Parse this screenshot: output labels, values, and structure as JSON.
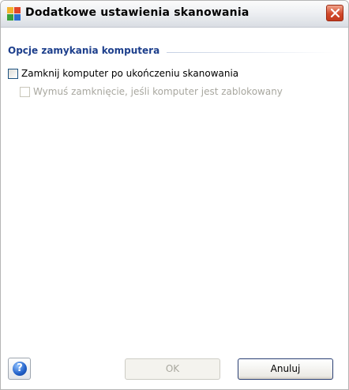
{
  "window": {
    "title": "Dodatkowe ustawienia skanowania"
  },
  "shutdown_group": {
    "title": "Opcje zamykania komputera",
    "options": [
      {
        "label": "Zamknij komputer po ukończeniu skanowania",
        "checked": false,
        "enabled": true
      },
      {
        "label": "Wymuś zamknięcie, jeśli komputer jest zablokowany",
        "checked": false,
        "enabled": false
      }
    ]
  },
  "footer": {
    "help_icon": "help-icon",
    "ok_label": "OK",
    "cancel_label": "Anuluj"
  },
  "colors": {
    "group_title": "#1d3f8c",
    "disabled_text": "#a8a79f",
    "close_button": "#d2492b"
  }
}
